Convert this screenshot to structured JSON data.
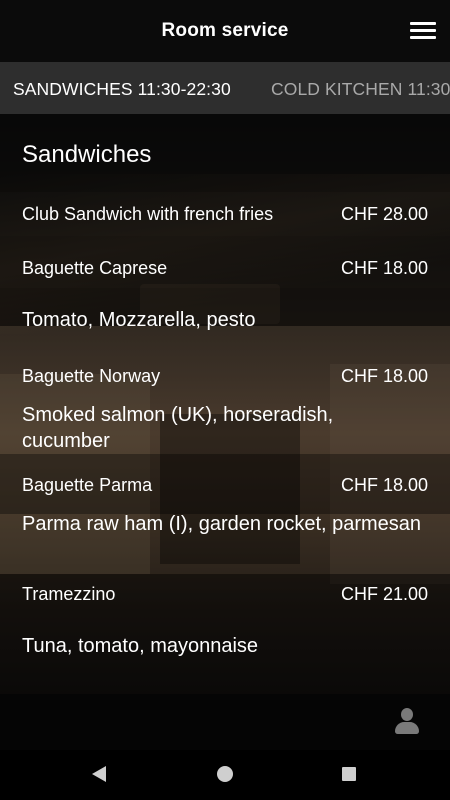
{
  "app_bar": {
    "title": "Room service",
    "menu_icon": "hamburger-menu-icon"
  },
  "tabs": [
    {
      "label": "SANDWICHES 11:30-22:30",
      "active": true
    },
    {
      "label": "COLD KITCHEN 11:30",
      "active": false
    }
  ],
  "section": {
    "title": "Sandwiches",
    "items": [
      {
        "name": "Club Sandwich with french fries",
        "price": "CHF 28.00",
        "description": ""
      },
      {
        "name": "Baguette Caprese",
        "price": "CHF 18.00",
        "description": "Tomato, Mozzarella, pesto"
      },
      {
        "name": "Baguette Norway",
        "price": "CHF 18.00",
        "description": "Smoked salmon (UK), horseradish, cucumber"
      },
      {
        "name": "Baguette Parma",
        "price": "CHF 18.00",
        "description": "Parma raw ham (I), garden rocket, parmesan"
      },
      {
        "name": "Tramezzino",
        "price": "CHF 21.00",
        "description": "Tuna, tomato, mayonnaise"
      }
    ]
  },
  "bottom": {
    "user_icon": "user-profile-icon"
  },
  "nav": {
    "back_icon": "back-triangle-icon",
    "home_icon": "home-circle-icon",
    "recent_icon": "recent-apps-square-icon"
  },
  "colors": {
    "app_bar_bg": "#0b0b0b",
    "tab_bar_bg": "#2e2e2e",
    "active_tab_text": "#ffffff",
    "inactive_tab_text": "#a9a9a9"
  }
}
